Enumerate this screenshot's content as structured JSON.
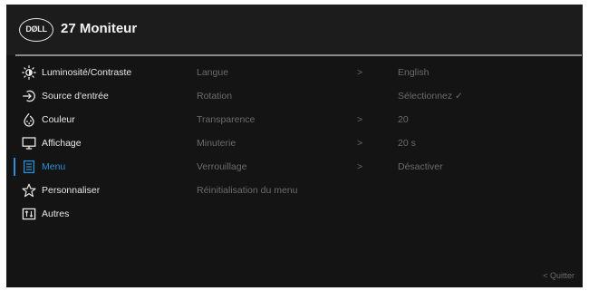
{
  "header": {
    "logo_text": "DØLL",
    "title": "27 Moniteur"
  },
  "sidebar": {
    "items": [
      {
        "label": "Luminosité/Contraste",
        "icon": "brightness-icon"
      },
      {
        "label": "Source d'entrée",
        "icon": "input-source-icon"
      },
      {
        "label": "Couleur",
        "icon": "color-palette-icon"
      },
      {
        "label": "Affichage",
        "icon": "display-icon"
      },
      {
        "label": "Menu",
        "icon": "menu-icon",
        "active": true
      },
      {
        "label": "Personnaliser",
        "icon": "star-icon"
      },
      {
        "label": "Autres",
        "icon": "others-icon"
      }
    ]
  },
  "submenu": {
    "rows": [
      {
        "label": "Langue",
        "arrow": ">",
        "value": "English"
      },
      {
        "label": "Rotation",
        "arrow": "",
        "value": "Sélectionnez ✓"
      },
      {
        "label": "Transparence",
        "arrow": ">",
        "value": "20"
      },
      {
        "label": "Minuterie",
        "arrow": ">",
        "value": "20 s"
      },
      {
        "label": "Verrouillage",
        "arrow": ">",
        "value": "Désactiver"
      },
      {
        "label": "Réinitialisation du menu",
        "arrow": "",
        "value": ""
      }
    ]
  },
  "footer": {
    "quit_label": "< Quitter"
  },
  "colors": {
    "accent": "#2a8fd6",
    "background": "#141414",
    "inactive_text": "#6b6b6b"
  }
}
